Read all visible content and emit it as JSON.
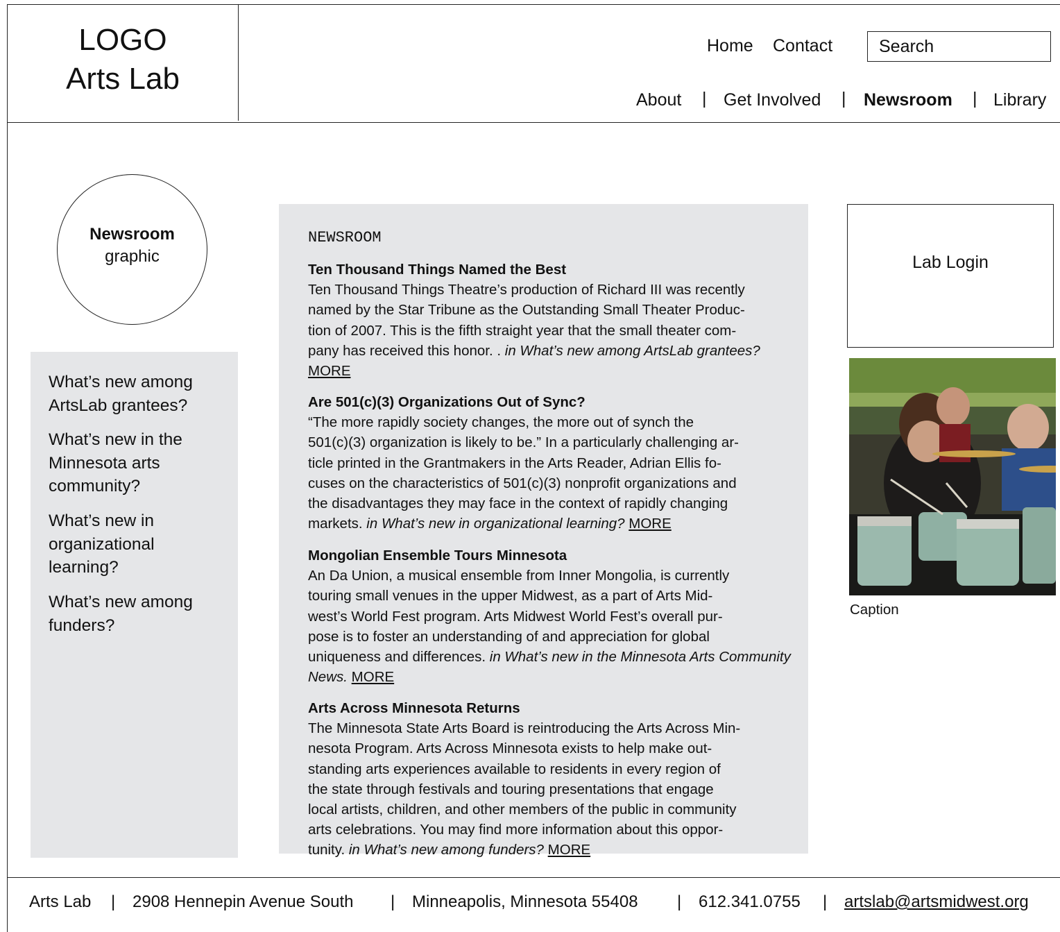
{
  "logo": {
    "line1": "LOGO",
    "line2": "Arts Lab"
  },
  "utility_nav": {
    "home": "Home",
    "contact": "Contact",
    "search_placeholder": "Search"
  },
  "main_nav": {
    "items": [
      "About",
      "Get Involved",
      "Newsroom",
      "Library"
    ],
    "separator": "|",
    "active": "Newsroom"
  },
  "section_graphic": {
    "title": "Newsroom",
    "subtitle": "graphic"
  },
  "sidebar": {
    "items": [
      [
        "What’s new among",
        "ArtsLab grantees?"
      ],
      [
        "What’s new in the",
        "Minnesota arts",
        "community?"
      ],
      [
        "What’s new in",
        "organizational",
        "learning?"
      ],
      [
        "What’s new among",
        "funders?"
      ]
    ]
  },
  "newsroom": {
    "heading": "NEWSROOM",
    "articles": [
      {
        "title": "Ten Thousand Things Named the Best",
        "lines": [
          "Ten Thousand Things Theatre’s production of Richard III was recently",
          "named by the Star Tribune as the Outstanding Small Theater Produc-",
          "tion of 2007.  This is the fifth straight year that the small theater com-",
          "pany has received this honor. . "
        ],
        "source": "in What’s new among ArtsLab grantees?",
        "more": "MORE"
      },
      {
        "title": "Are 501(c)(3) Organizations Out of Sync?",
        "lines": [
          "“The more rapidly society changes, the more out of synch the",
          "501(c)(3) organization is likely to be.”  In a particularly challenging ar-",
          "ticle printed in the Grantmakers in the Arts Reader, Adrian Ellis fo-",
          "cuses on the characteristics of 501(c)(3) nonprofit organizations and",
          "the disadvantages they may face in the context of rapidly changing",
          "markets.  "
        ],
        "source": "in What’s new in organizational learning?",
        "more": "MORE"
      },
      {
        "title": "Mongolian Ensemble Tours Minnesota",
        "lines": [
          "An Da Union, a musical ensemble from Inner Mongolia, is currently",
          "touring small venues in the upper Midwest, as a part of Arts Mid-",
          "west’s World Fest program.  Arts Midwest World Fest’s overall pur-",
          "pose is to foster an understanding of and appreciation for global",
          "uniqueness and differences.  "
        ],
        "source": "in What’s new in the Minnesota Arts Community News.",
        "more": "MORE"
      },
      {
        "title": "Arts Across Minnesota Returns",
        "lines": [
          "The Minnesota State Arts Board is reintroducing the Arts Across Min-",
          "nesota Program.  Arts Across Minnesota exists to help make out-",
          "standing arts experiences available to residents in every region of",
          "the state through festivals and touring presentations that engage",
          "local artists, children, and other members of the public in community",
          "arts celebrations.  You may find more information about this oppor-",
          "tunity. "
        ],
        "source": "in What’s new among funders?",
        "more": "MORE"
      }
    ]
  },
  "login": {
    "label": "Lab Login"
  },
  "photo": {
    "caption": "Caption"
  },
  "footer": {
    "name": "Arts Lab",
    "street": "2908 Hennepin Avenue South",
    "city": "Minneapolis, Minnesota  55408",
    "phone": "612.341.0755",
    "email": "artslab@artsmidwest.org",
    "separator": "|"
  }
}
